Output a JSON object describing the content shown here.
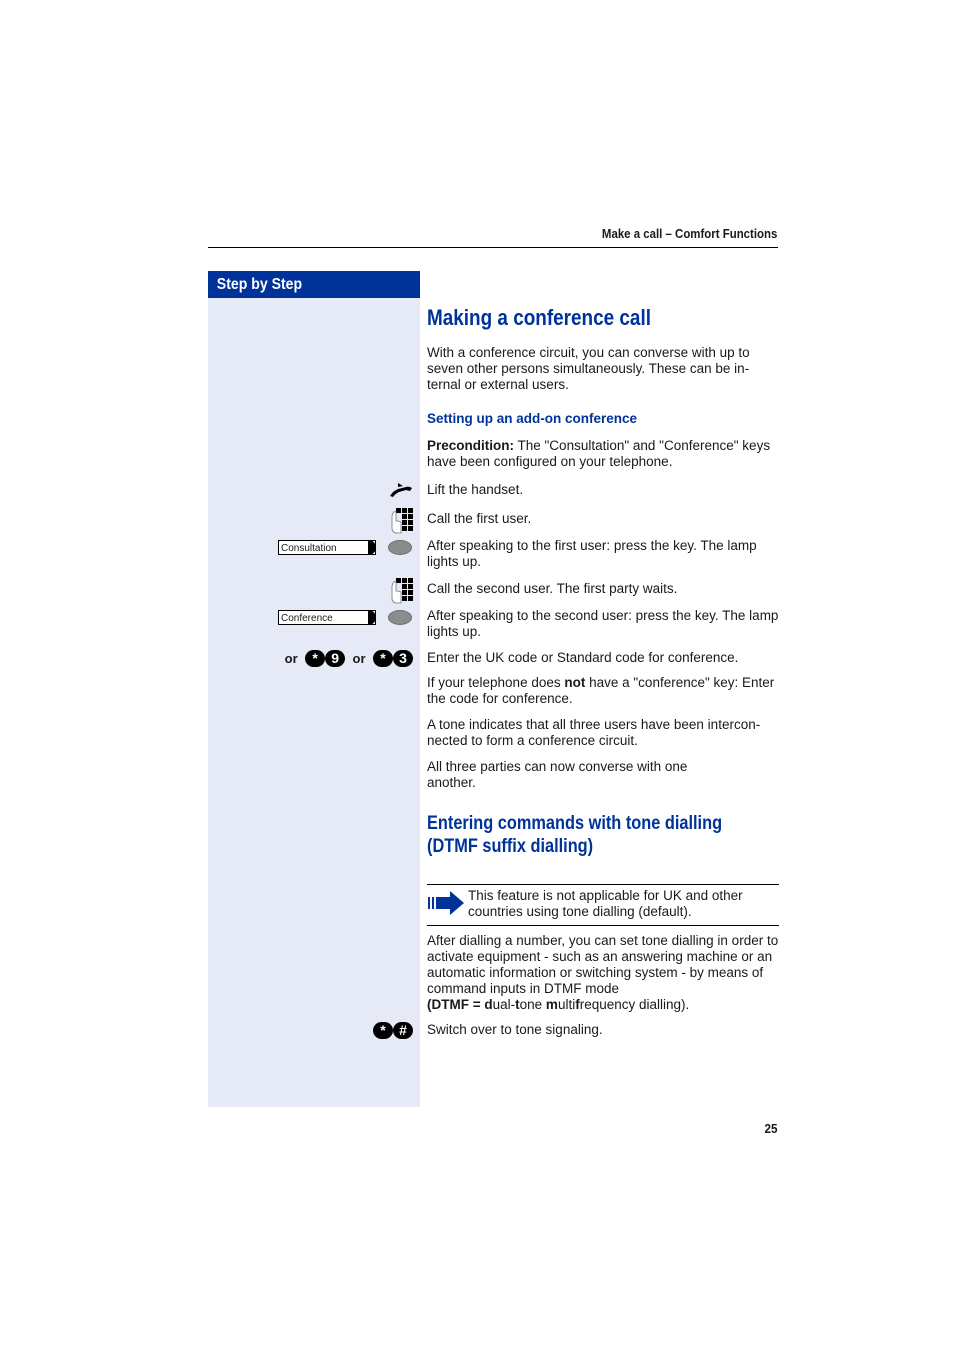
{
  "header": {
    "title": "Make a call – Comfort Functions"
  },
  "sidebar": {
    "title": "Step by Step",
    "keys": {
      "consultation": "Consultation",
      "conference": "Conference"
    },
    "codes": {
      "or1": "or",
      "or2": "or",
      "uk_code": [
        "*",
        "9"
      ],
      "standard_code": [
        "*",
        "3"
      ],
      "tone_code": [
        "*",
        "#"
      ]
    }
  },
  "section1": {
    "title": "Making a conference call",
    "intro": "With a conference circuit, you can converse with up to seven other persons simultaneously. These can be in-ternal or external users.",
    "subtitle": "Setting up an add-on conference",
    "precondition_label": "Precondition:",
    "precondition_text": " The \"Consultation\" and \"Conference\" keys have been configured on your telephone.",
    "steps": [
      "Lift the handset.",
      "Call the first user.",
      "After speaking to the first user: press the key. The lamp lights up.",
      "Call the second user. The first party waits.",
      "After speaking to the second user: press the key. The lamp lights up.",
      "Enter the UK code or Standard code for conference."
    ],
    "no_key_pre": "If your telephone does ",
    "no_key_bold": "not",
    "no_key_post": " have a \"conference\" key: Enter the code for conference.",
    "tone_info": "A tone indicates that all three users have been intercon-nected to form a conference circuit.",
    "converse": "All three parties can now converse with one another."
  },
  "section2": {
    "title_line1": "Entering commands with tone dialling",
    "title_line2": "(DTMF suffix dialling)",
    "note": "This feature is not applicable for UK and other countries using tone dialling (default).",
    "body": "After dialling a number, you can set tone dialling in order to activate equipment - such as an answering machine or an automatic information or switching system - by means of command inputs in DTMF mode",
    "dtmf": {
      "open": "(DTMF = ",
      "d": "d",
      "ual": "ual-",
      "t": "t",
      "one": "one ",
      "m": "m",
      "ulti": "ulti",
      "f": "f",
      "rest": "requency dialling)."
    },
    "step": "Switch over to tone signaling."
  },
  "footer": {
    "page_number": "25"
  }
}
